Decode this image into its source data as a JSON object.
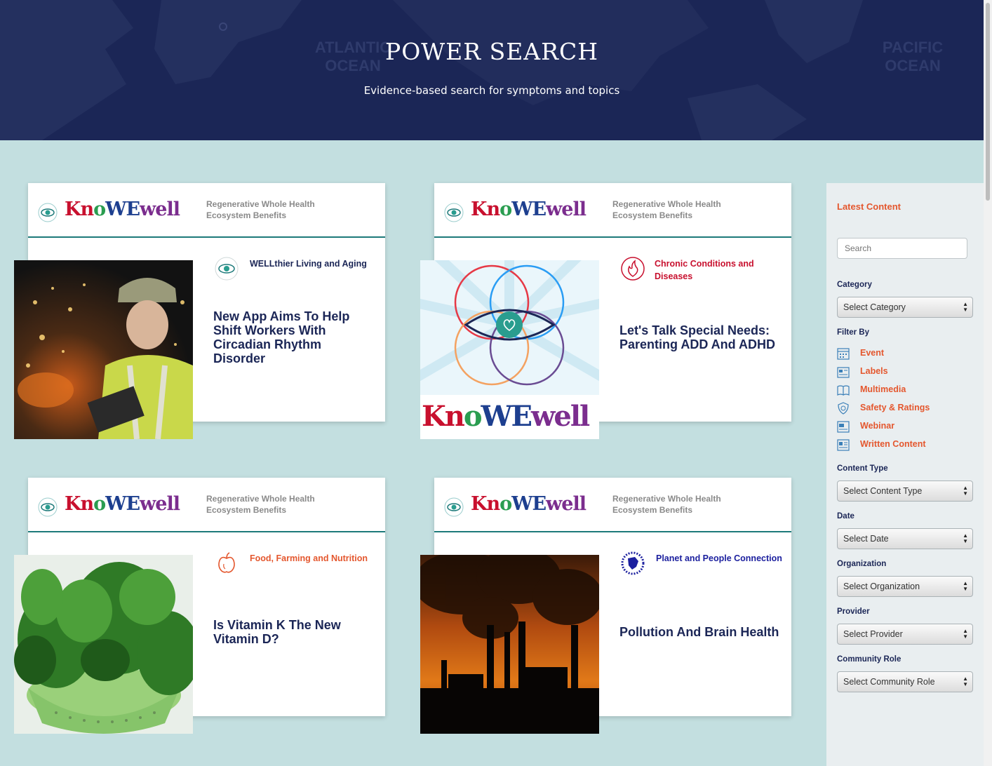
{
  "hero": {
    "title": "POWER SEARCH",
    "subtitle": "Evidence-based search for symptoms and topics",
    "map_labels": [
      "ATLANTIC",
      "OCEAN",
      "PACIFIC",
      "OCEAN"
    ]
  },
  "cards": [
    {
      "brand": "KnoWEwell",
      "ecosystem": "Regenerative Whole Health Ecosystem Benefits",
      "category": "WELLthier Living and Aging",
      "category_color": "#1b2656",
      "category_icon": "wellness-eye-icon",
      "title": "New App Aims To Help Shift Workers With Circadian Rhythm Disorder",
      "image": "worker-with-tablet-photo"
    },
    {
      "brand": "KnoWEwell",
      "ecosystem": "Regenerative Whole Health Ecosystem Benefits",
      "category": "Chronic Conditions and Diseases",
      "category_color": "#c8102e",
      "category_icon": "flame-circle-icon",
      "title": "Let's Talk Special Needs: Parenting ADD And ADHD",
      "image": "knowewell-logo-rings",
      "image_brand": "KnoWEwell"
    },
    {
      "brand": "KnoWEwell",
      "ecosystem": "Regenerative Whole Health Ecosystem Benefits",
      "category": "Food, Farming and Nutrition",
      "category_color": "#e4572e",
      "category_icon": "apple-icon",
      "title": "Is Vitamin K The New Vitamin D?",
      "image": "leafy-greens-photo"
    },
    {
      "brand": "KnoWEwell",
      "ecosystem": "Regenerative Whole Health Ecosystem Benefits",
      "category": "Planet and People Connection",
      "category_color": "#1b1f9e",
      "category_icon": "planet-people-icon",
      "title": "Pollution And Brain Health",
      "image": "smokestacks-photo"
    }
  ],
  "sidebar": {
    "heading": "Latest Content",
    "search_placeholder": "Search",
    "category_label": "Category",
    "category_value": "Select Category",
    "filter_label": "Filter By",
    "filters": [
      {
        "label": "Event",
        "icon": "calendar-icon"
      },
      {
        "label": "Labels",
        "icon": "labels-icon"
      },
      {
        "label": "Multimedia",
        "icon": "book-icon"
      },
      {
        "label": "Safety & Ratings",
        "icon": "shield-icon"
      },
      {
        "label": "Webinar",
        "icon": "webinar-icon"
      },
      {
        "label": "Written Content",
        "icon": "document-icon"
      }
    ],
    "content_type_label": "Content Type",
    "content_type_value": "Select Content Type",
    "date_label": "Date",
    "date_value": "Select Date",
    "organization_label": "Organization",
    "organization_value": "Select Organization",
    "provider_label": "Provider",
    "provider_value": "Select Provider",
    "community_role_label": "Community Role",
    "community_role_value": "Select Community Role"
  },
  "colors": {
    "hero_bg": "#1b2656",
    "page_bg": "#c3dfe0",
    "accent": "#e4572e",
    "title_navy": "#1b2656",
    "divider_teal": "#1d7a7a"
  }
}
